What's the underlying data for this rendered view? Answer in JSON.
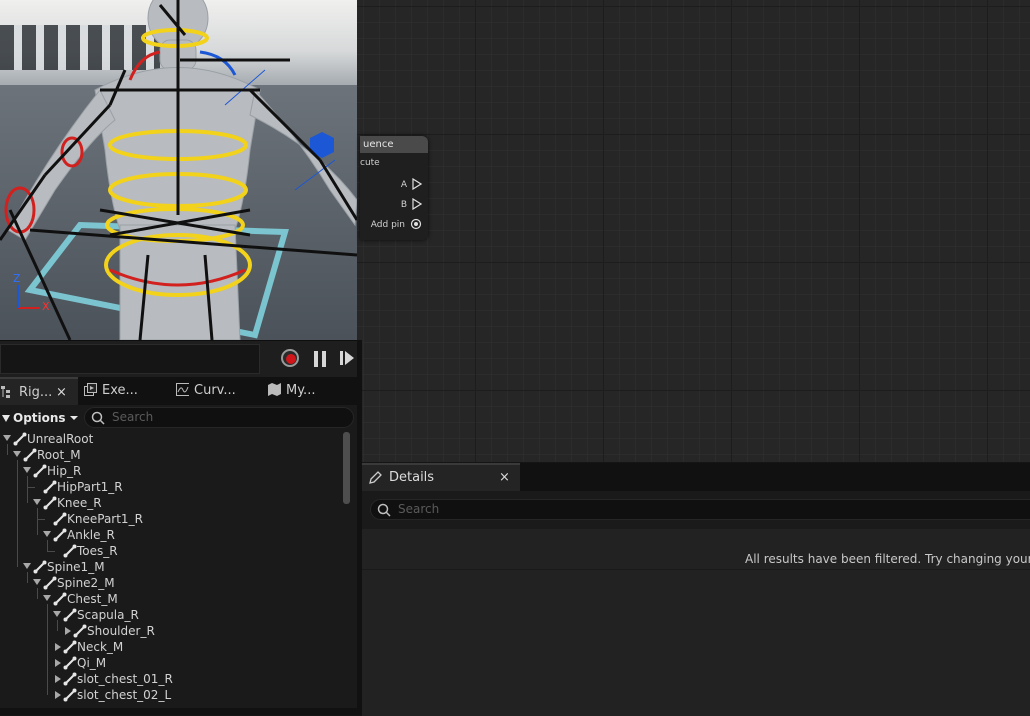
{
  "tabs": [
    {
      "label": "Rig..."
    },
    {
      "label": "Exe..."
    },
    {
      "label": "Curv..."
    },
    {
      "label": "My..."
    }
  ],
  "rig_panel": {
    "options_label": "Options",
    "search_placeholder": "Search",
    "tree": [
      {
        "label": "UnrealRoot",
        "depth": 0,
        "expanded": true
      },
      {
        "label": "Root_M",
        "depth": 1,
        "expanded": true
      },
      {
        "label": "Hip_R",
        "depth": 2,
        "expanded": true
      },
      {
        "label": "HipPart1_R",
        "depth": 3,
        "expanded": null
      },
      {
        "label": "Knee_R",
        "depth": 3,
        "expanded": true
      },
      {
        "label": "KneePart1_R",
        "depth": 4,
        "expanded": null
      },
      {
        "label": "Ankle_R",
        "depth": 4,
        "expanded": true
      },
      {
        "label": "Toes_R",
        "depth": 5,
        "expanded": null
      },
      {
        "label": "Spine1_M",
        "depth": 2,
        "expanded": true
      },
      {
        "label": "Spine2_M",
        "depth": 3,
        "expanded": true
      },
      {
        "label": "Chest_M",
        "depth": 4,
        "expanded": true
      },
      {
        "label": "Scapula_R",
        "depth": 5,
        "expanded": true
      },
      {
        "label": "Shoulder_R",
        "depth": 6,
        "expanded": false
      },
      {
        "label": "Neck_M",
        "depth": 5,
        "expanded": false
      },
      {
        "label": "Qi_M",
        "depth": 5,
        "expanded": false
      },
      {
        "label": "slot_chest_01_R",
        "depth": 5,
        "expanded": false
      },
      {
        "label": "slot_chest_02_L",
        "depth": 5,
        "expanded": false
      }
    ]
  },
  "graph_node": {
    "title": "uence",
    "subtitle": "cute",
    "pins": [
      {
        "label": "A",
        "kind": "exec"
      },
      {
        "label": "B",
        "kind": "exec"
      },
      {
        "label": "Add pin",
        "kind": "add"
      }
    ]
  },
  "details": {
    "tab_label": "Details",
    "close_label": "×",
    "search_placeholder": "Search",
    "empty_message": "All results have been filtered. Try changing your ac"
  },
  "viewport": {
    "axis_x": "X",
    "axis_z": "Z"
  },
  "close_label": "×",
  "colors": {
    "control_yellow": "#f2d21a",
    "control_red": "#d2201e",
    "control_blue": "#1c57d6",
    "ground_plane_cyan": "#7fd0dc",
    "record_red": "#d0161b"
  }
}
